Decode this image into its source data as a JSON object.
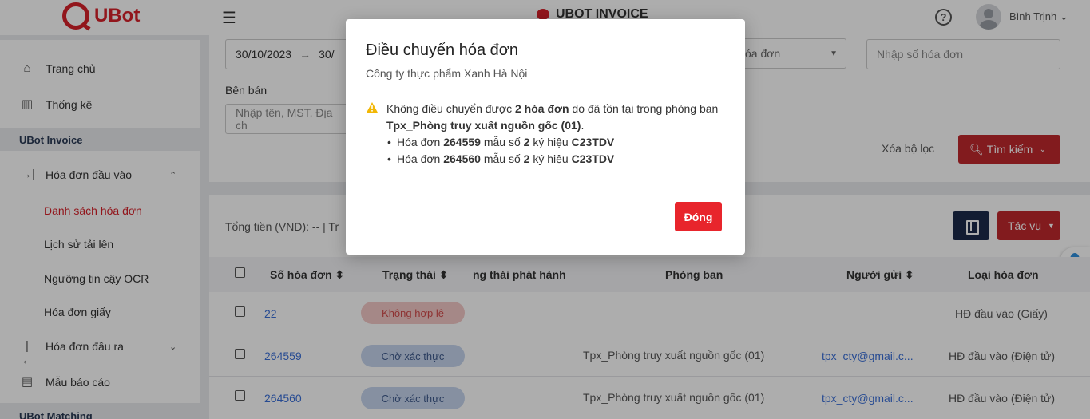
{
  "header": {
    "logo_text": "UBot",
    "app_title": "UBOT INVOICE",
    "help_label": "?",
    "user_name": "Bình Trịnh"
  },
  "sidebar": {
    "items": [
      {
        "label": "Trang chủ",
        "icon": "home-icon"
      },
      {
        "label": "Thống kê",
        "icon": "chart-icon"
      }
    ],
    "section_invoice": "UBot Invoice",
    "inbound": {
      "label": "Hóa đơn đầu vào",
      "icon": "inbound-icon"
    },
    "sub_items": [
      "Danh sách hóa đơn",
      "Lịch sử tải lên",
      "Ngưỡng tin cậy OCR",
      "Hóa đơn giấy"
    ],
    "outbound": {
      "label": "Hóa đơn đầu ra",
      "icon": "outbound-icon"
    },
    "report": {
      "label": "Mẫu báo cáo",
      "icon": "report-icon"
    },
    "section_matching": "UBot Matching"
  },
  "filters": {
    "date_from": "30/10/2023",
    "date_arrow": "→",
    "date_to_partial": "30/",
    "invoice_type_partial": "óa đơn",
    "invoice_number_placeholder": "Nhập số hóa đơn",
    "seller_label": "Bên bán",
    "seller_placeholder_partial": "Nhập tên, MST, Địa ch",
    "clear_label": "Xóa bộ lọc",
    "search_label": "Tìm kiếm"
  },
  "table": {
    "total_label": "Tổng tiền (VND): -- | Tr",
    "action_label": "Tác vụ",
    "headers": [
      "Số hóa đơn",
      "Trạng thái",
      "ng thái phát hành",
      "Phòng ban",
      "Người gửi",
      "Loại hóa đơn"
    ],
    "rows": [
      {
        "number": "22",
        "status": "Không hợp lệ",
        "department": "",
        "sender": "",
        "type": "HĐ đầu vào (Giấy)"
      },
      {
        "number": "264559",
        "status": "Chờ xác thực",
        "department": "Tpx_Phòng truy xuất nguồn gốc (01)",
        "sender": "tpx_cty@gmail.c...",
        "type": "HĐ đầu vào (Điện tử)"
      },
      {
        "number": "264560",
        "status": "Chờ xác thực",
        "department": "Tpx_Phòng truy xuất nguồn gốc (01)",
        "sender": "tpx_cty@gmail.c...",
        "type": "HĐ đầu vào (Điện tử)"
      }
    ]
  },
  "modal": {
    "title": "Điều chuyển hóa đơn",
    "subtitle": "Công ty thực phẩm Xanh Hà Nội",
    "warn_prefix": "Không điều chuyển được ",
    "warn_count": "2 hóa đơn",
    "warn_mid": " do đã tồn tại trong phòng ban ",
    "warn_dept": "Tpx_Phòng truy xuất nguồn gốc (01)",
    "warn_end": ".",
    "items": [
      {
        "prefix": "Hóa đơn ",
        "number": "264559",
        "mid1": " mẫu số ",
        "form": "2",
        "mid2": " ký hiệu ",
        "symbol": "C23TDV"
      },
      {
        "prefix": "Hóa đơn ",
        "number": "264560",
        "mid1": " mẫu số ",
        "form": "2",
        "mid2": " ký hiệu ",
        "symbol": "C23TDV"
      }
    ],
    "close_label": "Đóng"
  },
  "colors": {
    "brand_red": "#d7212a",
    "button_red": "#e8252c",
    "navy": "#1b2a4a",
    "link_blue": "#3a6fd8"
  }
}
